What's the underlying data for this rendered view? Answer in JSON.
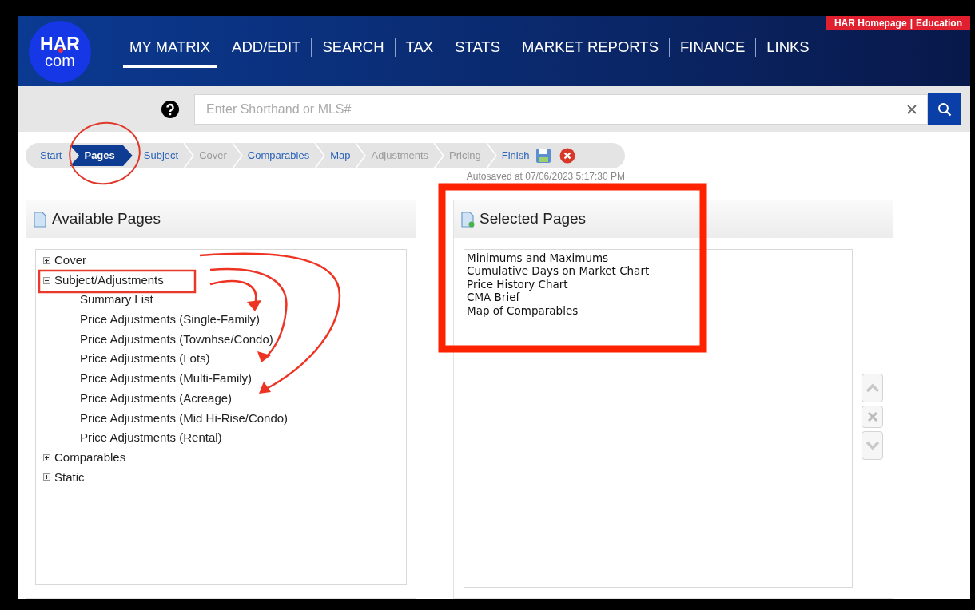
{
  "header": {
    "logo": {
      "line1": "HAR",
      "line2": "com"
    },
    "top_links": {
      "items": [
        "HAR Homepage",
        "Education"
      ],
      "separator": "|"
    },
    "nav": [
      {
        "label": "MY MATRIX",
        "selected": true
      },
      {
        "label": "ADD/EDIT",
        "selected": false
      },
      {
        "label": "SEARCH",
        "selected": false
      },
      {
        "label": "TAX",
        "selected": false
      },
      {
        "label": "STATS",
        "selected": false
      },
      {
        "label": "MARKET REPORTS",
        "selected": false
      },
      {
        "label": "FINANCE",
        "selected": false
      },
      {
        "label": "LINKS",
        "selected": false
      }
    ]
  },
  "search": {
    "placeholder": "Enter Shorthand or MLS#"
  },
  "wizard": {
    "steps": [
      {
        "label": "Start",
        "selected": false,
        "disabled": false
      },
      {
        "label": "Pages",
        "selected": true,
        "disabled": false
      },
      {
        "label": "Subject",
        "selected": false,
        "disabled": false
      },
      {
        "label": "Cover",
        "selected": false,
        "disabled": true
      },
      {
        "label": "Comparables",
        "selected": false,
        "disabled": false
      },
      {
        "label": "Map",
        "selected": false,
        "disabled": false
      },
      {
        "label": "Adjustments",
        "selected": false,
        "disabled": true
      },
      {
        "label": "Pricing",
        "selected": false,
        "disabled": true
      },
      {
        "label": "Finish",
        "selected": false,
        "disabled": false
      }
    ],
    "autosave": "Autosaved at 07/06/2023 5:17:30 PM"
  },
  "available_pages": {
    "title": "Available Pages",
    "tree": [
      {
        "label": "Cover",
        "expanded": false
      },
      {
        "label": "Subject/Adjustments",
        "expanded": true,
        "children": [
          {
            "label": "Summary List"
          },
          {
            "label": "Price Adjustments (Single-Family)"
          },
          {
            "label": "Price Adjustments (Townhse/Condo)"
          },
          {
            "label": "Price Adjustments (Lots)"
          },
          {
            "label": "Price Adjustments (Multi-Family)"
          },
          {
            "label": "Price Adjustments (Acreage)"
          },
          {
            "label": "Price Adjustments (Mid Hi-Rise/Condo)"
          },
          {
            "label": "Price Adjustments (Rental)"
          }
        ]
      },
      {
        "label": "Comparables",
        "expanded": false
      },
      {
        "label": "Static",
        "expanded": false
      }
    ]
  },
  "selected_pages": {
    "title": "Selected Pages",
    "items": [
      "Minimums and Maximums",
      "Cumulative Days on Market Chart",
      "Price History Chart",
      "CMA Brief",
      "Map of Comparables"
    ]
  }
}
